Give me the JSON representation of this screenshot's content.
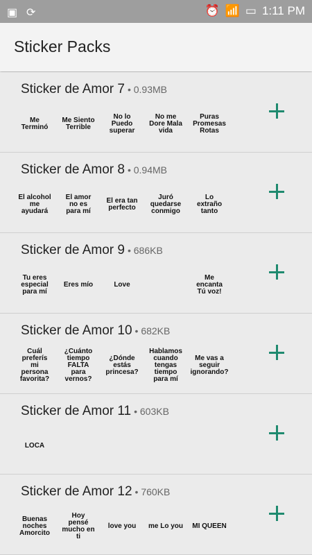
{
  "status": {
    "time": "1:11 PM"
  },
  "header": {
    "title": "Sticker Packs"
  },
  "packs": [
    {
      "name": "Sticker de Amor 7",
      "size": "0.93MB",
      "stickers": [
        "Me Terminó",
        "Me Siento Terrible",
        "No lo Puedo superar",
        "No me Dore Mala vida",
        "Puras Promesas Rotas"
      ]
    },
    {
      "name": "Sticker de Amor 8",
      "size": "0.94MB",
      "stickers": [
        "El alcohol me ayudará",
        "El amor no es para mí",
        "El era tan perfecto",
        "Juró quedarse conmigo",
        "Lo extraño tanto"
      ]
    },
    {
      "name": "Sticker de Amor 9",
      "size": "686KB",
      "stickers": [
        "Tu eres especial para mí",
        "Eres mío",
        "Love",
        "",
        "Me encanta Tú voz!"
      ]
    },
    {
      "name": "Sticker de Amor 10",
      "size": "682KB",
      "stickers": [
        "Cuál preferís mi persona favorita?",
        "¿Cuánto tiempo FALTA para vernos?",
        "¿Dónde estás princesa?",
        "Hablamos cuando tengas tiempo para mí",
        "Me vas a seguir ignorando?"
      ]
    },
    {
      "name": "Sticker de Amor 11",
      "size": "603KB",
      "stickers": [
        "LOCA",
        "",
        "",
        "",
        ""
      ]
    },
    {
      "name": "Sticker de Amor 12",
      "size": "760KB",
      "stickers": [
        "Buenas noches Amorcito",
        "Hoy pensé mucho en ti",
        "love you",
        "me Lo you",
        "MI QUEEN"
      ]
    }
  ]
}
